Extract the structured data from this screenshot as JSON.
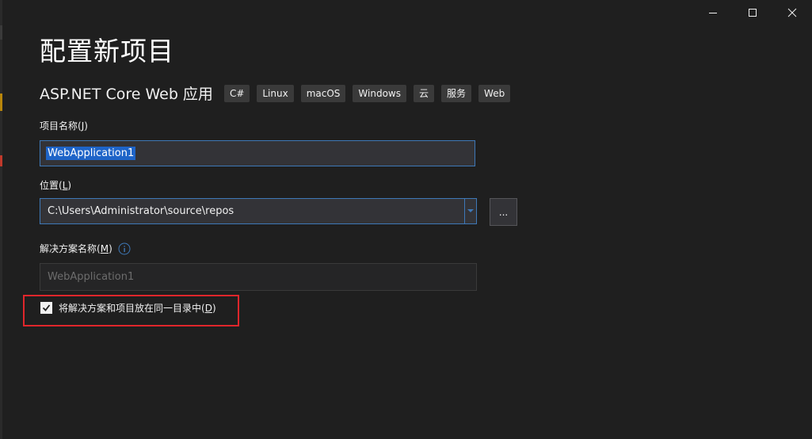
{
  "window": {
    "title": "配置新项目",
    "controls": {
      "minimize": "minimize-icon",
      "maximize": "maximize-icon",
      "close": "close-icon"
    }
  },
  "project_type": {
    "name": "ASP.NET Core Web 应用",
    "tags": [
      "C#",
      "Linux",
      "macOS",
      "Windows",
      "云",
      "服务",
      "Web"
    ]
  },
  "form": {
    "project_name_label": "项目名称",
    "project_name_hotkey": "J",
    "project_name_value": "WebApplication1",
    "location_label": "位置",
    "location_hotkey": "L",
    "location_value": "C:\\Users\\Administrator\\source\\repos",
    "browse_label": "...",
    "solution_name_label": "解决方案名称",
    "solution_name_hotkey": "M",
    "solution_name_placeholder": "WebApplication1",
    "same_dir_checkbox_label": "将解决方案和项目放在同一目录中",
    "same_dir_hotkey": "D",
    "same_dir_checked": true
  },
  "colors": {
    "background": "#1f1f1f",
    "field_border_focus": "#3e78b7",
    "selection": "#1e64c8",
    "highlight_box": "#e0262b"
  }
}
